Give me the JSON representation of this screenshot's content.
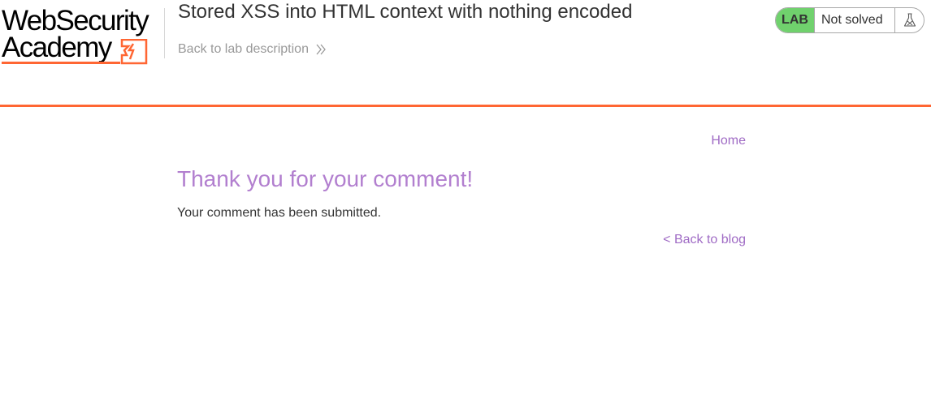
{
  "header": {
    "logo": {
      "line1": "WebSecurity",
      "line2": "Academy"
    },
    "lab_title": "Stored XSS into HTML context with nothing encoded",
    "back_link": "Back to lab description"
  },
  "lab_status": {
    "badge": "LAB",
    "state": "Not solved",
    "icon": "flask-icon"
  },
  "navigation": {
    "home": "Home"
  },
  "main": {
    "heading": "Thank you for your comment!",
    "message": "Your comment has been submitted.",
    "back_to_blog": "< Back to blog"
  },
  "colors": {
    "accent_orange": "#ff6633",
    "link_purple": "#a06cc5",
    "heading_purple": "#b27fcf",
    "lab_green": "#70d16d"
  }
}
